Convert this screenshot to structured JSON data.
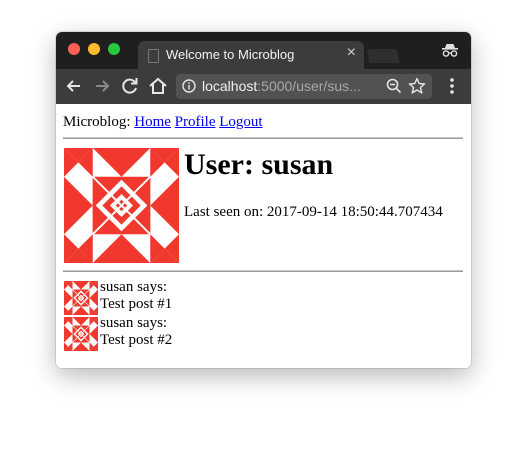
{
  "window": {
    "tab_title": "Welcome to Microblog",
    "url_host": "localhost",
    "url_path": ":5000/user/sus...",
    "colors": {
      "close": "#ff5f57",
      "minimize": "#febc2e",
      "maximize": "#28c840"
    }
  },
  "nav": {
    "brand": "Microblog:",
    "links": [
      "Home",
      "Profile",
      "Logout"
    ]
  },
  "profile": {
    "heading": "User: susan",
    "last_seen": "Last seen on: 2017-09-14 18:50:44.707434",
    "avatar_color": "#f0382e"
  },
  "posts": [
    {
      "author": "susan says:",
      "body": "Test post #1"
    },
    {
      "author": "susan says:",
      "body": "Test post #2"
    }
  ]
}
